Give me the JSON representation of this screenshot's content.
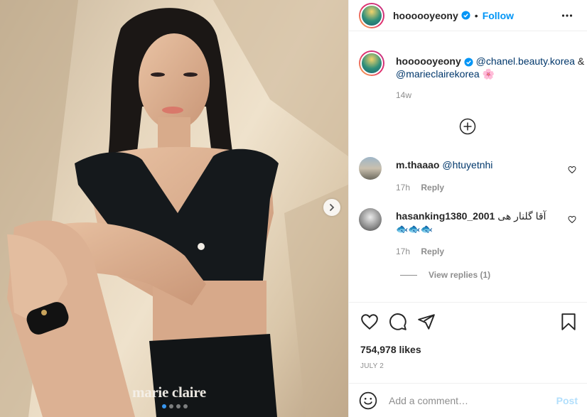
{
  "post": {
    "username": "hoooooyeony",
    "follow_label": "Follow",
    "separator": "•",
    "watermark": "marie claire",
    "carousel_active_index": 0,
    "carousel_count": 4,
    "caption": {
      "username": "hoooooyeony",
      "mention_1": "@chanel.beauty.korea",
      "joiner": "&",
      "mention_2": "@marieclairekorea",
      "emoji": "🌸",
      "time": "14w"
    },
    "comments": [
      {
        "username": "m.thaaao",
        "text": "@htuyetnhi",
        "time": "17h",
        "reply_label": "Reply"
      },
      {
        "username": "hasanking1380_2001",
        "text": "آقا گلنار هی",
        "emoji": "🐟🐟🐟",
        "time": "17h",
        "reply_label": "Reply"
      }
    ],
    "view_replies_label": "View replies (1)",
    "likes_label": "754,978 likes",
    "date_label": "JULY 2",
    "comment_placeholder": "Add a comment…",
    "post_label": "Post"
  },
  "icons": {
    "more": "more-options-icon",
    "verified": "verified-badge-icon",
    "next": "chevron-right-icon",
    "like": "heart-icon",
    "comment": "comment-icon",
    "share": "share-icon",
    "save": "bookmark-icon",
    "emoji": "emoji-icon",
    "load_more": "plus-circle-icon"
  },
  "colors": {
    "accent": "#0095f6",
    "mention": "#00376b",
    "muted": "#8e8e8e",
    "post_disabled": "#b2dffc"
  }
}
